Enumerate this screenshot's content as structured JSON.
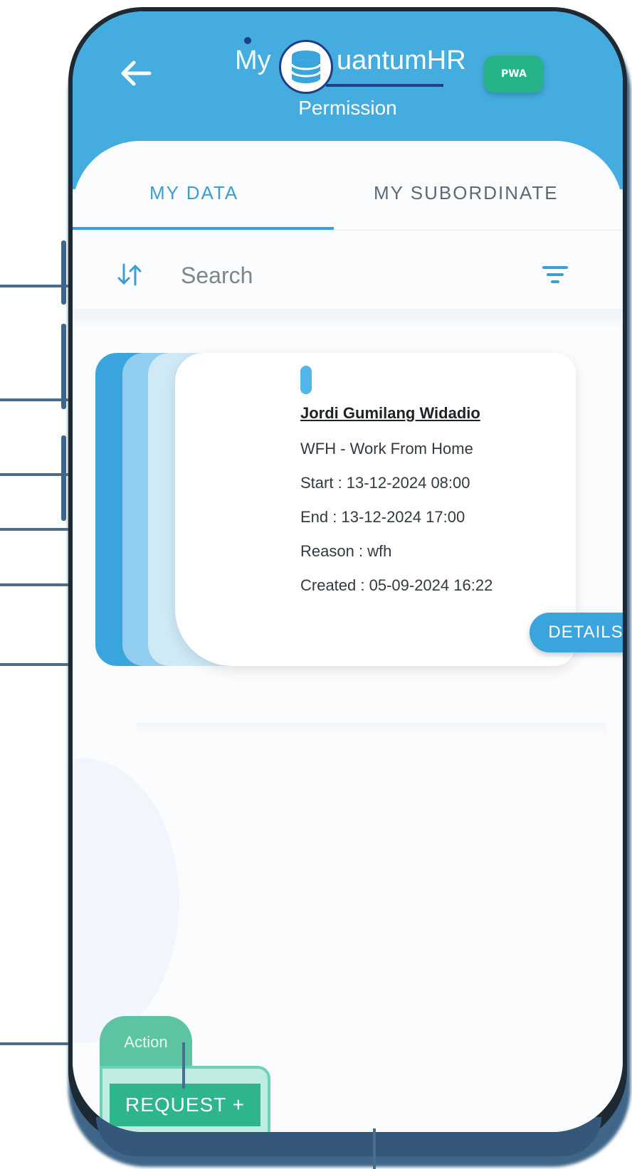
{
  "header": {
    "back_icon": "arrow-left-icon",
    "logo_prefix": "My",
    "logo_suffix": "uantumHR",
    "logo_icon": "database-icon",
    "badge": "PWA",
    "title": "Permission"
  },
  "tabs": [
    {
      "label": "MY DATA",
      "active": true
    },
    {
      "label": "MY SUBORDINATE",
      "active": false
    }
  ],
  "search": {
    "sort_icon": "sort-icon",
    "placeholder": "Search",
    "filter_icon": "filter-icon"
  },
  "card": {
    "name": "Jordi Gumilang Widadio",
    "type": "WFH - Work From Home",
    "start": "Start : 13-12-2024 08:00",
    "end": "End : 13-12-2024 17:00",
    "reason": "Reason : wfh",
    "created": "Created : 05-09-2024 16:22",
    "details_label": "DETAILS"
  },
  "action": {
    "label": "Action",
    "request_label": "REQUEST +"
  },
  "colors": {
    "header": "#45acdf",
    "accent": "#3aa4dc",
    "action": "#2fb58c"
  }
}
